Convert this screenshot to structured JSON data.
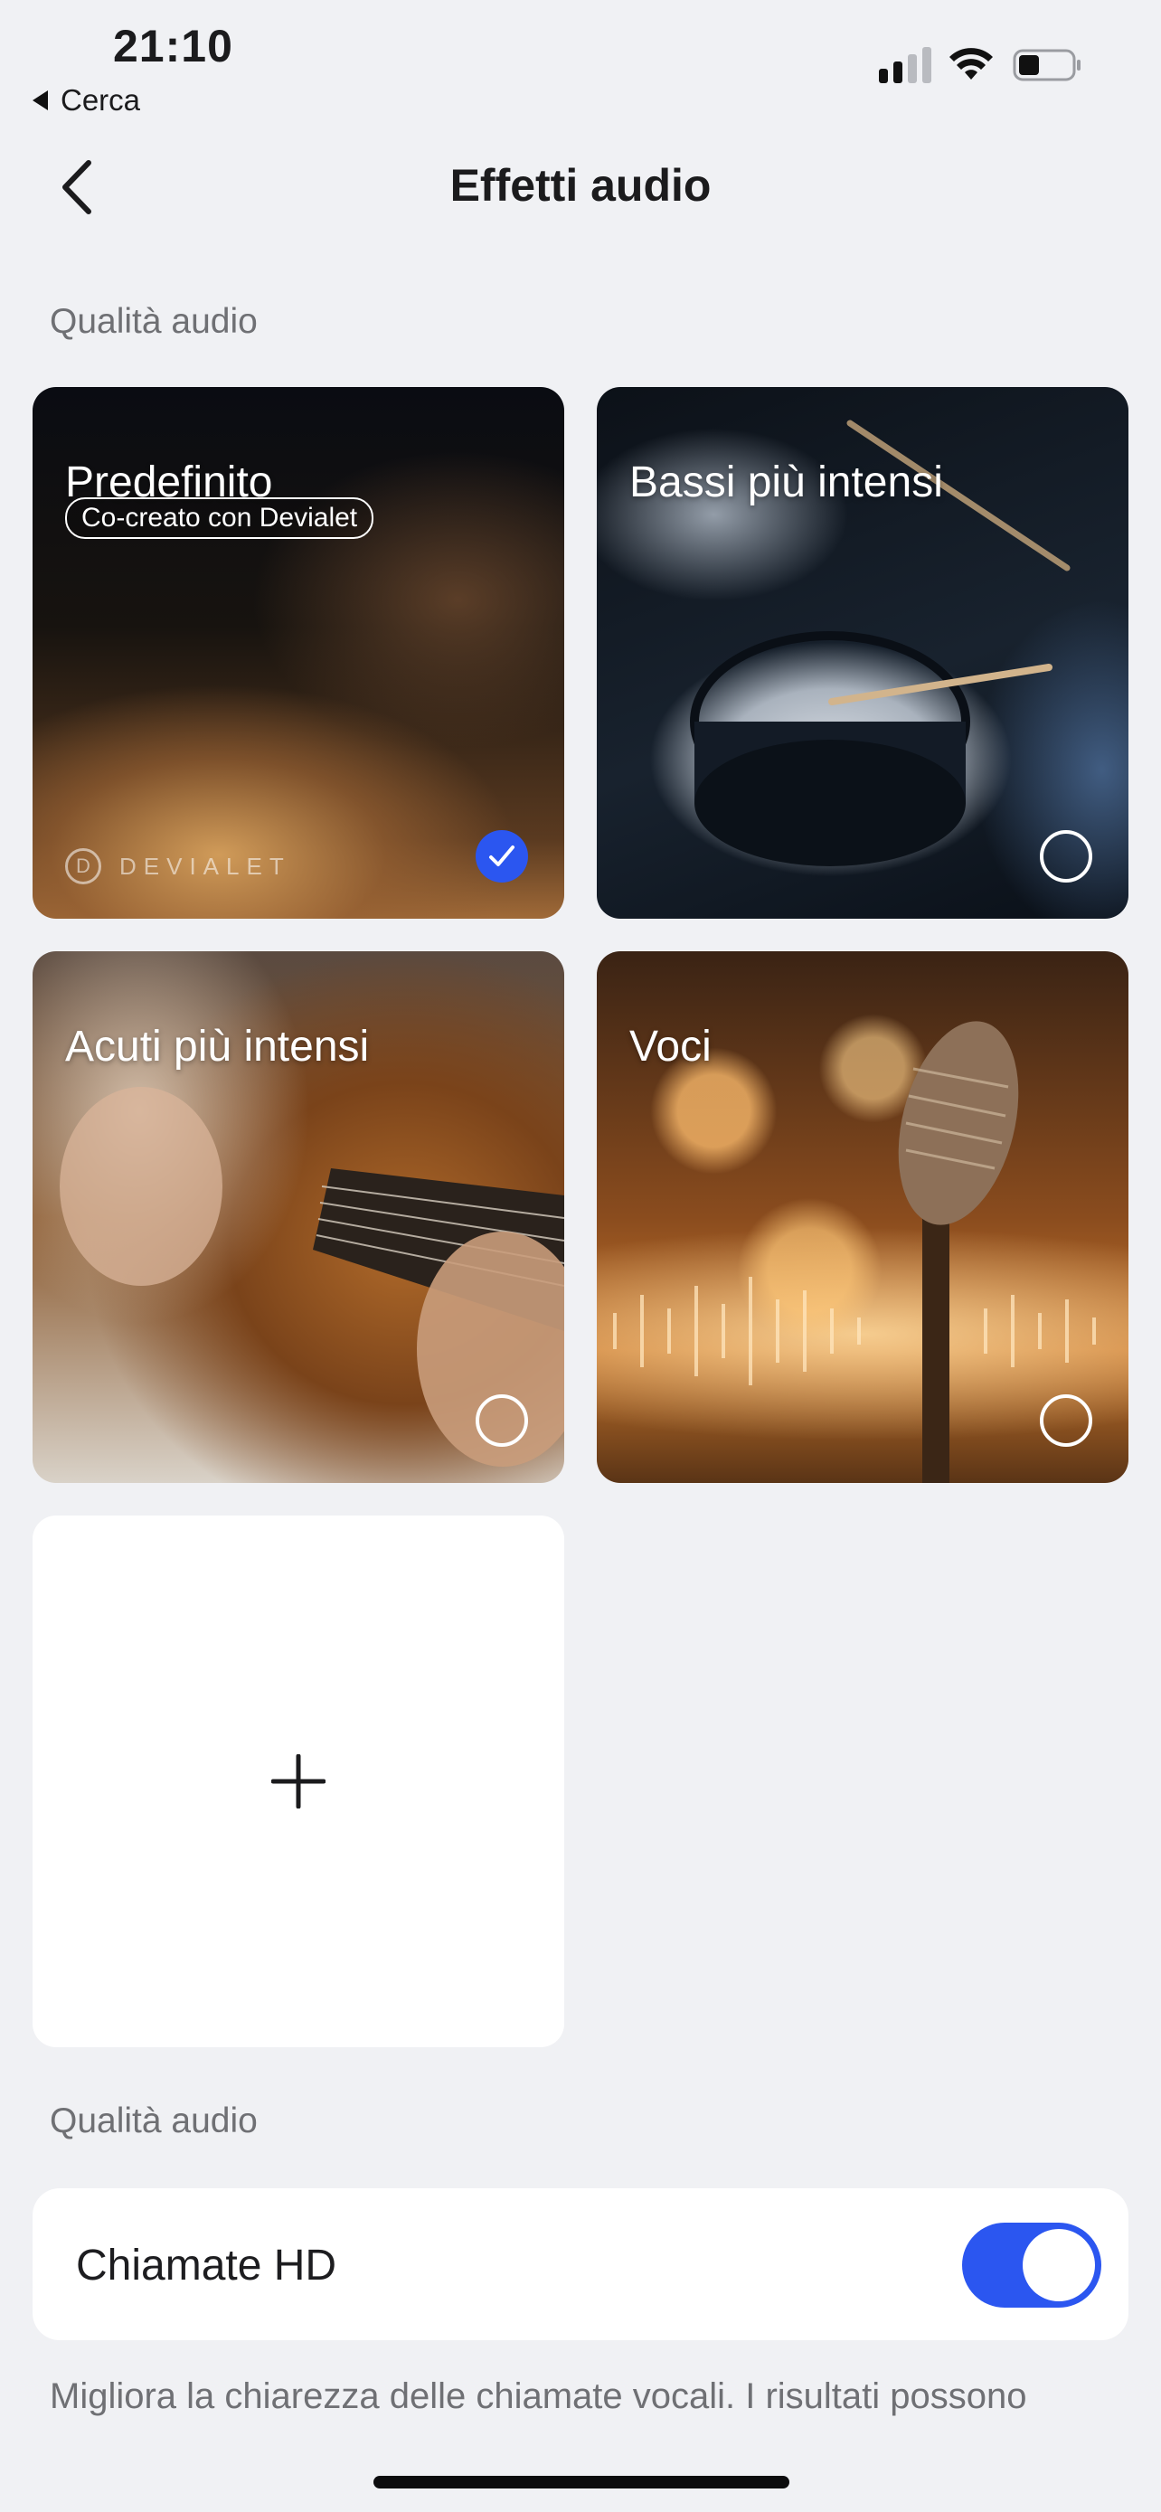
{
  "status_bar": {
    "time": "21:10",
    "back_app": "Cerca",
    "icons": [
      "cellular-signal-icon",
      "wifi-icon",
      "battery-icon"
    ]
  },
  "nav": {
    "title": "Effetti audio",
    "back_icon": "chevron-left-icon"
  },
  "sections": {
    "audio_quality_label": "Qualità audio",
    "calls_label": "Qualità audio"
  },
  "tiles": [
    {
      "title": "Predefinito",
      "badge": "Co-creato con Devialet",
      "brand": "DEVIALET",
      "brand_initial": "D",
      "selected": true
    },
    {
      "title": "Bassi più intensi",
      "selected": false
    },
    {
      "title": "Acuti più intensi",
      "selected": false
    },
    {
      "title": "Voci",
      "selected": false
    }
  ],
  "add_tile": {
    "icon": "plus-icon"
  },
  "hd_calls": {
    "label": "Chiamate HD",
    "enabled": true,
    "description": "Migliora la chiarezza delle chiamate vocali. I risultati possono"
  },
  "colors": {
    "accent": "#2b56f0",
    "background": "#f0f1f4",
    "secondary_text": "#6f7074"
  }
}
